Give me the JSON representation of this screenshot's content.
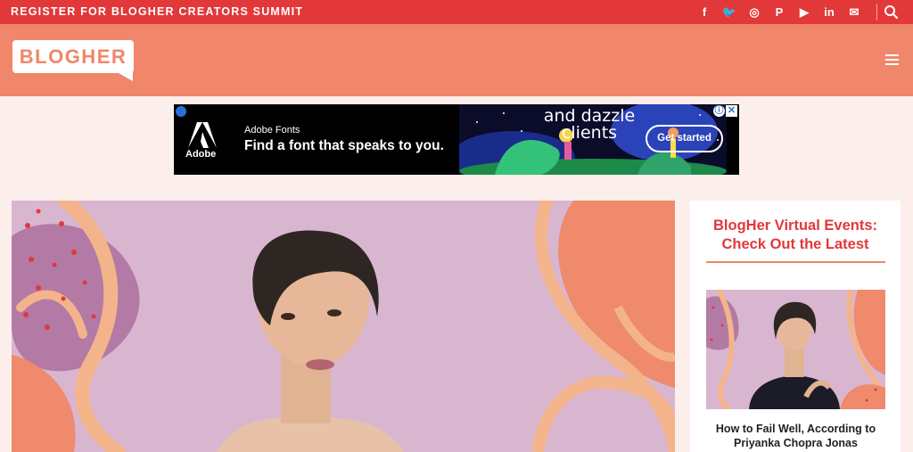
{
  "topbar": {
    "register_label": "REGISTER FOR BLOGHER CREATORS SUMMIT",
    "social": [
      {
        "icon": "facebook-icon",
        "glyph": "f"
      },
      {
        "icon": "twitter-icon",
        "glyph": "🐦"
      },
      {
        "icon": "instagram-icon",
        "glyph": "◎"
      },
      {
        "icon": "pinterest-icon",
        "glyph": "P"
      },
      {
        "icon": "youtube-icon",
        "glyph": "▶"
      },
      {
        "icon": "linkedin-icon",
        "glyph": "in"
      },
      {
        "icon": "email-icon",
        "glyph": "✉"
      }
    ],
    "search_icon": "search-icon"
  },
  "header": {
    "logo_text": "BLOGHER",
    "menu_icon": "hamburger-icon"
  },
  "ad": {
    "logo_text": "Adobe",
    "brand": "Adobe Fonts",
    "tagline": "Find a font that speaks to you.",
    "art_text": "and dazzle clients",
    "cta": "Get started",
    "info_icon": "ⓘ",
    "close_icon": "✕"
  },
  "sidebar": {
    "title": "BlogHer Virtual Events: Check Out the Latest",
    "article_caption": "How to Fail Well, According to Priyanka Chopra Jonas"
  },
  "colors": {
    "topbar": "#e2383a",
    "header": "#f0866a",
    "page_bg": "#fcefeb",
    "hero_bg": "#d9b6d0",
    "accent_red": "#e2383a"
  }
}
